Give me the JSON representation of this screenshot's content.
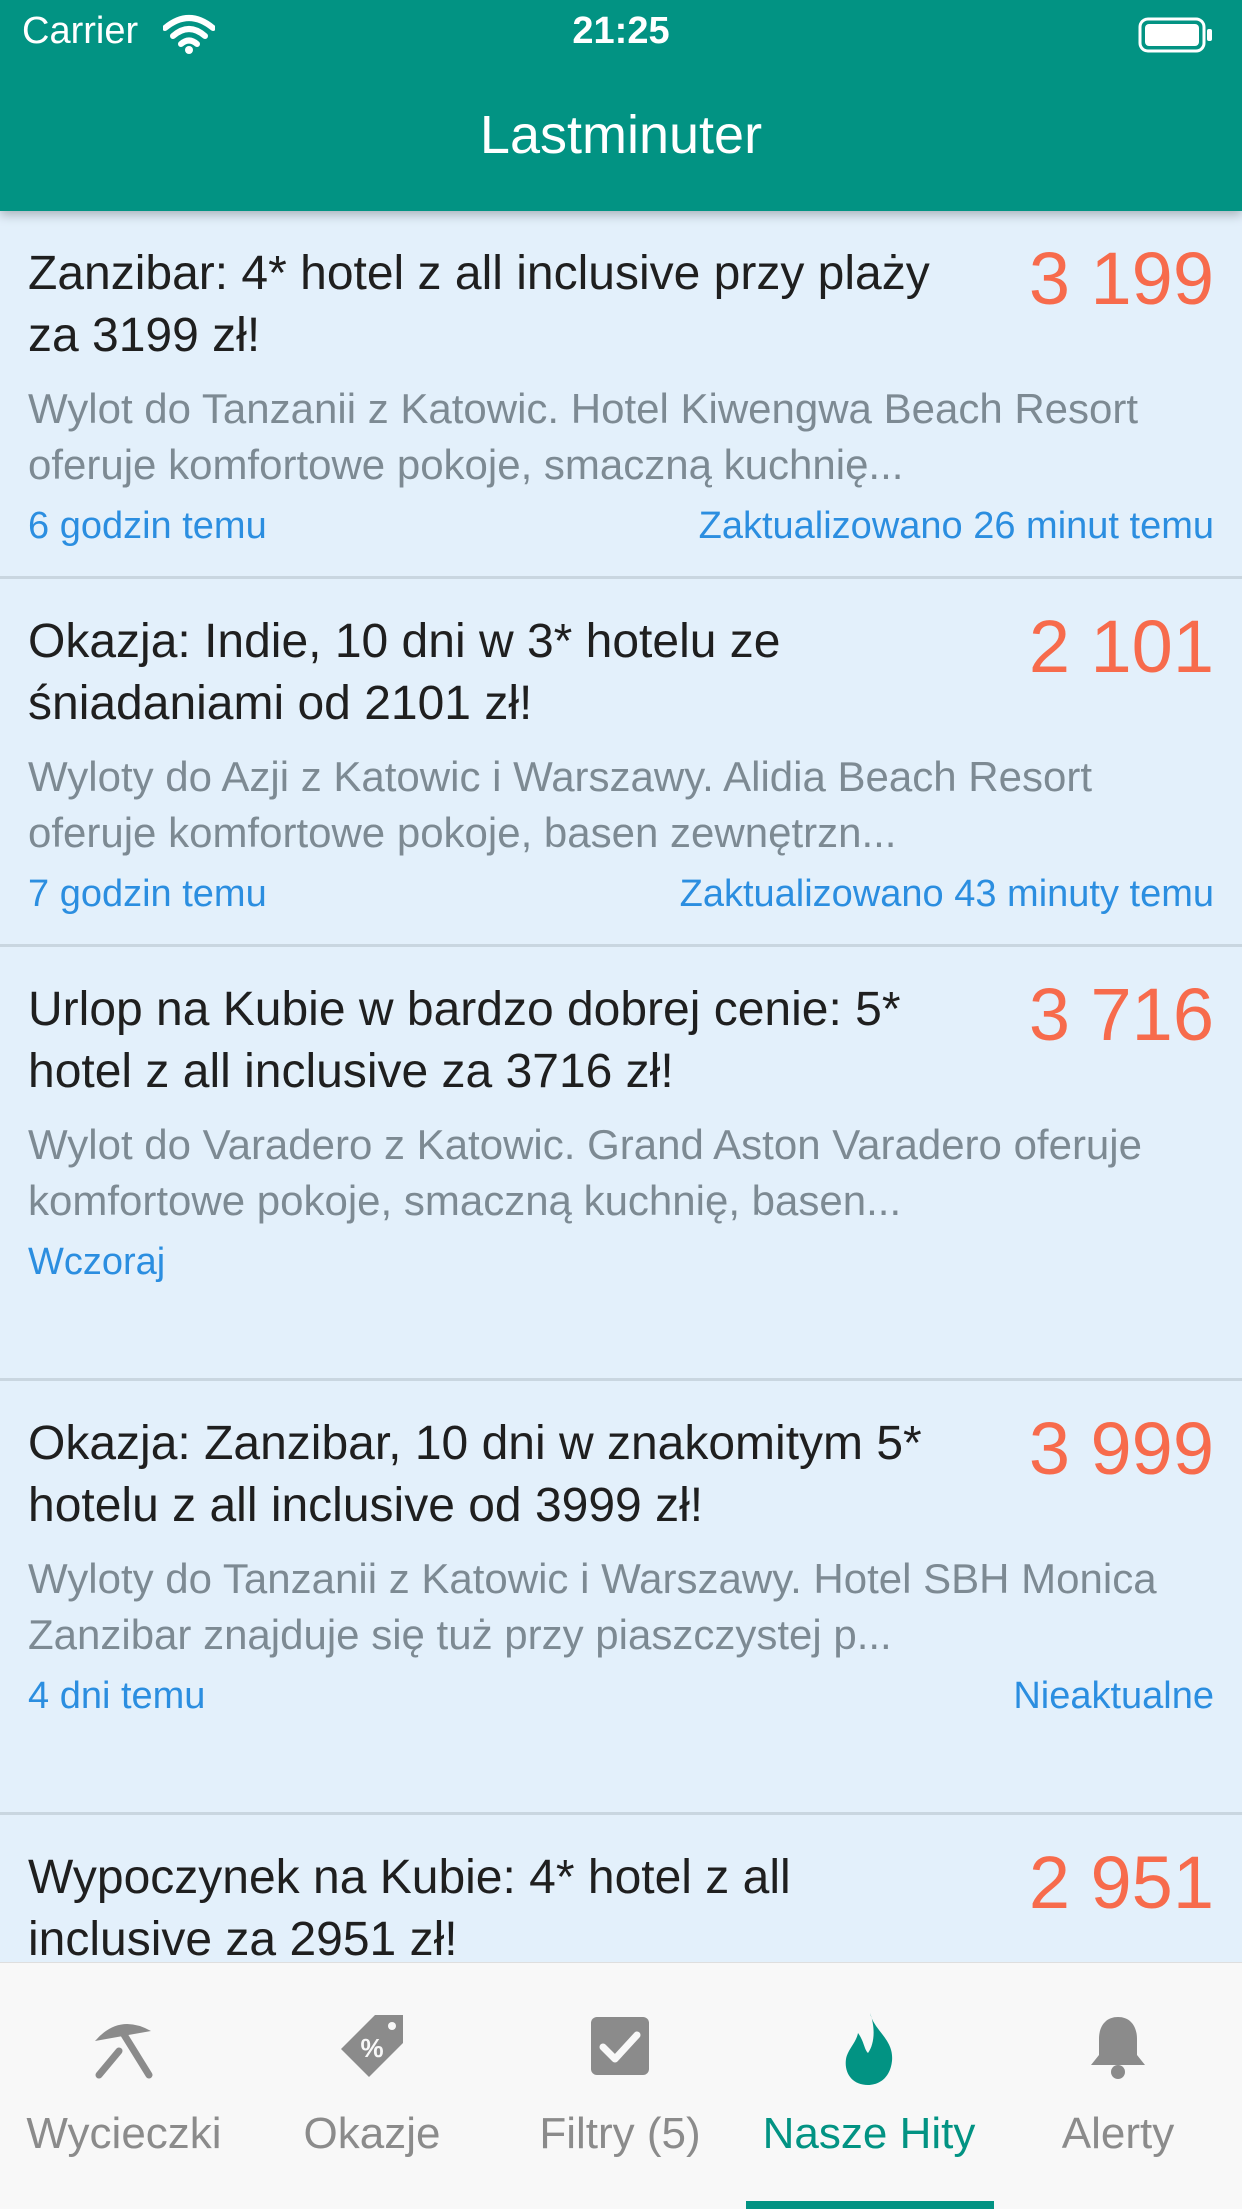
{
  "status_bar": {
    "carrier": "Carrier",
    "time": "21:25"
  },
  "header": {
    "title": "Lastminuter"
  },
  "deals": [
    {
      "title": "Zanzibar: 4* hotel z all inclusive przy plaży za 3199 zł!",
      "price": "3 199",
      "description": "Wylot do Tanzanii z Katowic. Hotel Kiwengwa Beach Resort oferuje komfortowe pokoje, smaczną kuchnię...",
      "posted": "6 godzin temu",
      "updated": "Zaktualizowano 26 minut temu"
    },
    {
      "title": "Okazja: Indie, 10 dni w 3* hotelu ze śniadaniami od 2101 zł!",
      "price": "2 101",
      "description": "Wyloty do Azji z Katowic i Warszawy. Alidia Beach Resort oferuje komfortowe pokoje, basen zewnętrzn...",
      "posted": "7 godzin temu",
      "updated": "Zaktualizowano 43 minuty temu"
    },
    {
      "title": "Urlop na Kubie w bardzo dobrej cenie: 5* hotel z all inclusive za 3716 zł!",
      "price": "3 716",
      "description": "Wylot do Varadero z Katowic. Grand Aston Varadero oferuje komfortowe pokoje, smaczną kuchnię, basen...",
      "posted": "Wczoraj",
      "updated": ""
    },
    {
      "title": "Okazja: Zanzibar, 10 dni w znakomitym 5* hotelu z all inclusive od 3999 zł!",
      "price": "3 999",
      "description": "Wyloty do Tanzanii z Katowic i Warszawy. Hotel SBH Monica Zanzibar znajduje się tuż przy piaszczystej p...",
      "posted": "4 dni temu",
      "updated": "Nieaktualne"
    },
    {
      "title": "Wypoczynek na Kubie: 4* hotel z all inclusive za 2951 zł!",
      "price": "2 951",
      "description": "",
      "posted": "",
      "updated": ""
    }
  ],
  "tabs": [
    {
      "label": "Wycieczki",
      "icon": "umbrella-icon",
      "active": false
    },
    {
      "label": "Okazje",
      "icon": "tag-icon",
      "active": false
    },
    {
      "label": "Filtry (5)",
      "icon": "checkbox-icon",
      "active": false
    },
    {
      "label": "Nasze Hity",
      "icon": "flame-icon",
      "active": true
    },
    {
      "label": "Alerty",
      "icon": "bell-icon",
      "active": false
    }
  ],
  "colors": {
    "primary": "#029383",
    "price": "#f76b4c",
    "link": "#2b8ee0",
    "card_bg": "#e3f0fb",
    "tab_inactive": "#8b8b8b"
  }
}
